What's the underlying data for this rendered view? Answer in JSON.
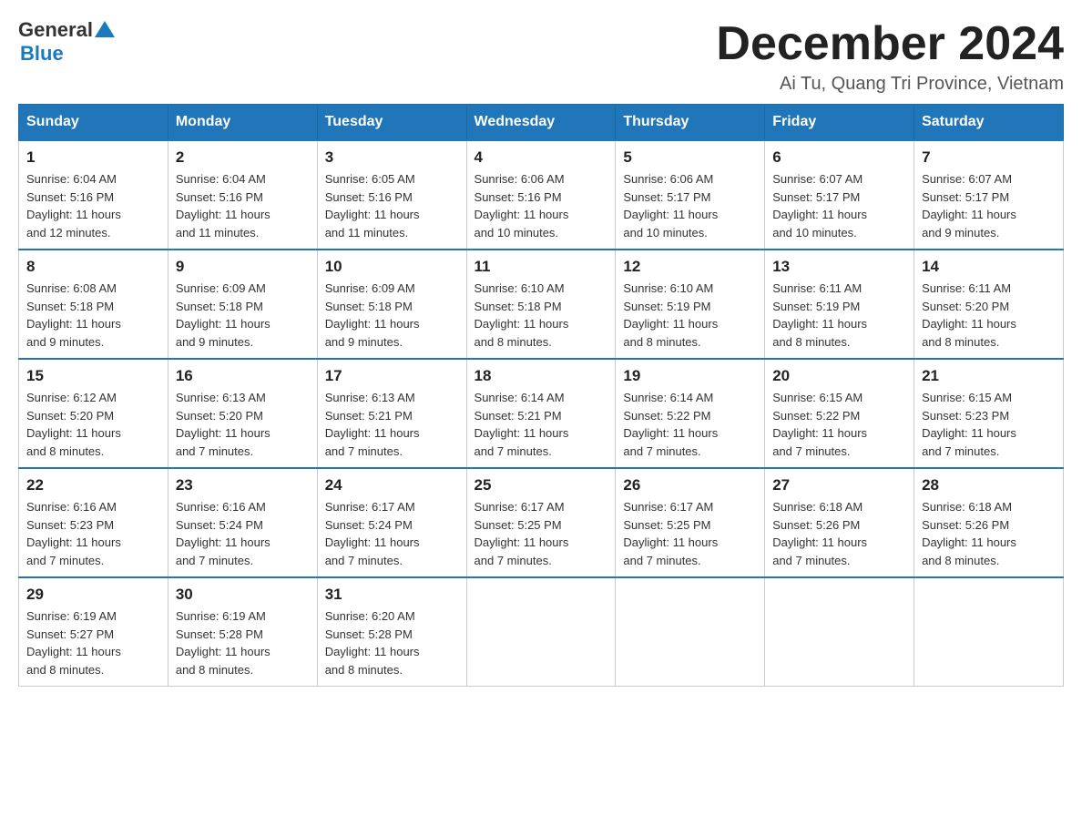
{
  "header": {
    "logo": {
      "text_general": "General",
      "text_blue": "Blue",
      "triangle_color": "#1a7abf"
    },
    "month_title": "December 2024",
    "location": "Ai Tu, Quang Tri Province, Vietnam"
  },
  "days_of_week": [
    "Sunday",
    "Monday",
    "Tuesday",
    "Wednesday",
    "Thursday",
    "Friday",
    "Saturday"
  ],
  "weeks": [
    {
      "days": [
        {
          "num": "1",
          "sunrise": "6:04 AM",
          "sunset": "5:16 PM",
          "daylight": "11 hours and 12 minutes."
        },
        {
          "num": "2",
          "sunrise": "6:04 AM",
          "sunset": "5:16 PM",
          "daylight": "11 hours and 11 minutes."
        },
        {
          "num": "3",
          "sunrise": "6:05 AM",
          "sunset": "5:16 PM",
          "daylight": "11 hours and 11 minutes."
        },
        {
          "num": "4",
          "sunrise": "6:06 AM",
          "sunset": "5:16 PM",
          "daylight": "11 hours and 10 minutes."
        },
        {
          "num": "5",
          "sunrise": "6:06 AM",
          "sunset": "5:17 PM",
          "daylight": "11 hours and 10 minutes."
        },
        {
          "num": "6",
          "sunrise": "6:07 AM",
          "sunset": "5:17 PM",
          "daylight": "11 hours and 10 minutes."
        },
        {
          "num": "7",
          "sunrise": "6:07 AM",
          "sunset": "5:17 PM",
          "daylight": "11 hours and 9 minutes."
        }
      ]
    },
    {
      "days": [
        {
          "num": "8",
          "sunrise": "6:08 AM",
          "sunset": "5:18 PM",
          "daylight": "11 hours and 9 minutes."
        },
        {
          "num": "9",
          "sunrise": "6:09 AM",
          "sunset": "5:18 PM",
          "daylight": "11 hours and 9 minutes."
        },
        {
          "num": "10",
          "sunrise": "6:09 AM",
          "sunset": "5:18 PM",
          "daylight": "11 hours and 9 minutes."
        },
        {
          "num": "11",
          "sunrise": "6:10 AM",
          "sunset": "5:18 PM",
          "daylight": "11 hours and 8 minutes."
        },
        {
          "num": "12",
          "sunrise": "6:10 AM",
          "sunset": "5:19 PM",
          "daylight": "11 hours and 8 minutes."
        },
        {
          "num": "13",
          "sunrise": "6:11 AM",
          "sunset": "5:19 PM",
          "daylight": "11 hours and 8 minutes."
        },
        {
          "num": "14",
          "sunrise": "6:11 AM",
          "sunset": "5:20 PM",
          "daylight": "11 hours and 8 minutes."
        }
      ]
    },
    {
      "days": [
        {
          "num": "15",
          "sunrise": "6:12 AM",
          "sunset": "5:20 PM",
          "daylight": "11 hours and 8 minutes."
        },
        {
          "num": "16",
          "sunrise": "6:13 AM",
          "sunset": "5:20 PM",
          "daylight": "11 hours and 7 minutes."
        },
        {
          "num": "17",
          "sunrise": "6:13 AM",
          "sunset": "5:21 PM",
          "daylight": "11 hours and 7 minutes."
        },
        {
          "num": "18",
          "sunrise": "6:14 AM",
          "sunset": "5:21 PM",
          "daylight": "11 hours and 7 minutes."
        },
        {
          "num": "19",
          "sunrise": "6:14 AM",
          "sunset": "5:22 PM",
          "daylight": "11 hours and 7 minutes."
        },
        {
          "num": "20",
          "sunrise": "6:15 AM",
          "sunset": "5:22 PM",
          "daylight": "11 hours and 7 minutes."
        },
        {
          "num": "21",
          "sunrise": "6:15 AM",
          "sunset": "5:23 PM",
          "daylight": "11 hours and 7 minutes."
        }
      ]
    },
    {
      "days": [
        {
          "num": "22",
          "sunrise": "6:16 AM",
          "sunset": "5:23 PM",
          "daylight": "11 hours and 7 minutes."
        },
        {
          "num": "23",
          "sunrise": "6:16 AM",
          "sunset": "5:24 PM",
          "daylight": "11 hours and 7 minutes."
        },
        {
          "num": "24",
          "sunrise": "6:17 AM",
          "sunset": "5:24 PM",
          "daylight": "11 hours and 7 minutes."
        },
        {
          "num": "25",
          "sunrise": "6:17 AM",
          "sunset": "5:25 PM",
          "daylight": "11 hours and 7 minutes."
        },
        {
          "num": "26",
          "sunrise": "6:17 AM",
          "sunset": "5:25 PM",
          "daylight": "11 hours and 7 minutes."
        },
        {
          "num": "27",
          "sunrise": "6:18 AM",
          "sunset": "5:26 PM",
          "daylight": "11 hours and 7 minutes."
        },
        {
          "num": "28",
          "sunrise": "6:18 AM",
          "sunset": "5:26 PM",
          "daylight": "11 hours and 8 minutes."
        }
      ]
    },
    {
      "days": [
        {
          "num": "29",
          "sunrise": "6:19 AM",
          "sunset": "5:27 PM",
          "daylight": "11 hours and 8 minutes."
        },
        {
          "num": "30",
          "sunrise": "6:19 AM",
          "sunset": "5:28 PM",
          "daylight": "11 hours and 8 minutes."
        },
        {
          "num": "31",
          "sunrise": "6:20 AM",
          "sunset": "5:28 PM",
          "daylight": "11 hours and 8 minutes."
        },
        null,
        null,
        null,
        null
      ]
    }
  ],
  "labels": {
    "sunrise": "Sunrise:",
    "sunset": "Sunset:",
    "daylight": "Daylight:"
  }
}
